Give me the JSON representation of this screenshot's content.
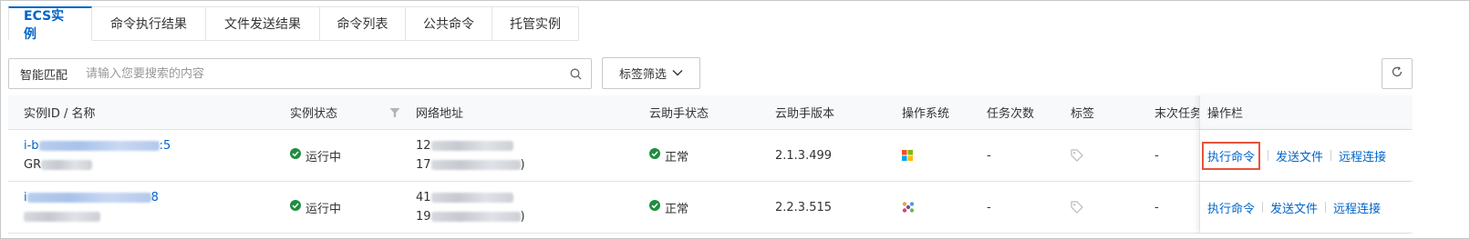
{
  "tabs": [
    "ECS实例",
    "命令执行结果",
    "文件发送结果",
    "命令列表",
    "公共命令",
    "托管实例"
  ],
  "search": {
    "label": "智能匹配",
    "placeholder": "请输入您要搜索的内容"
  },
  "tag_filter": {
    "label": "标签筛选"
  },
  "table": {
    "headers": {
      "id_name": "实例ID / 名称",
      "status": "实例状态",
      "network": "网络地址",
      "assistant_status": "云助手状态",
      "assistant_version": "云助手版本",
      "os": "操作系统",
      "task_count": "任务次数",
      "tags": "标签",
      "last_task": "末次任务",
      "actions": "操作栏"
    },
    "rows": [
      {
        "id_prefix": "i-b",
        "id_suffix": ":5",
        "name_prefix": "GR",
        "status": "运行中",
        "ip1_prefix": "12",
        "ip2_prefix": "17",
        "ip2_suffix": ")",
        "assistant_status": "正常",
        "assistant_version": "2.1.3.499",
        "os_icon": "windows-icon",
        "task_count": "-",
        "last_task": "-"
      },
      {
        "id_prefix": "i",
        "id_suffix": "8",
        "name_prefix": "",
        "status": "运行中",
        "ip1_prefix": "41",
        "ip2_prefix": "19",
        "ip2_suffix": ")",
        "assistant_status": "正常",
        "assistant_version": "2.2.3.515",
        "os_icon": "linux-distro-icon",
        "task_count": "-",
        "last_task": "-"
      }
    ],
    "actions": {
      "run": "执行命令",
      "send": "发送文件",
      "remote": "远程连接"
    }
  },
  "colors": {
    "accent": "#0064c8",
    "success": "#1e8e3e",
    "highlight": "#e5533c"
  }
}
